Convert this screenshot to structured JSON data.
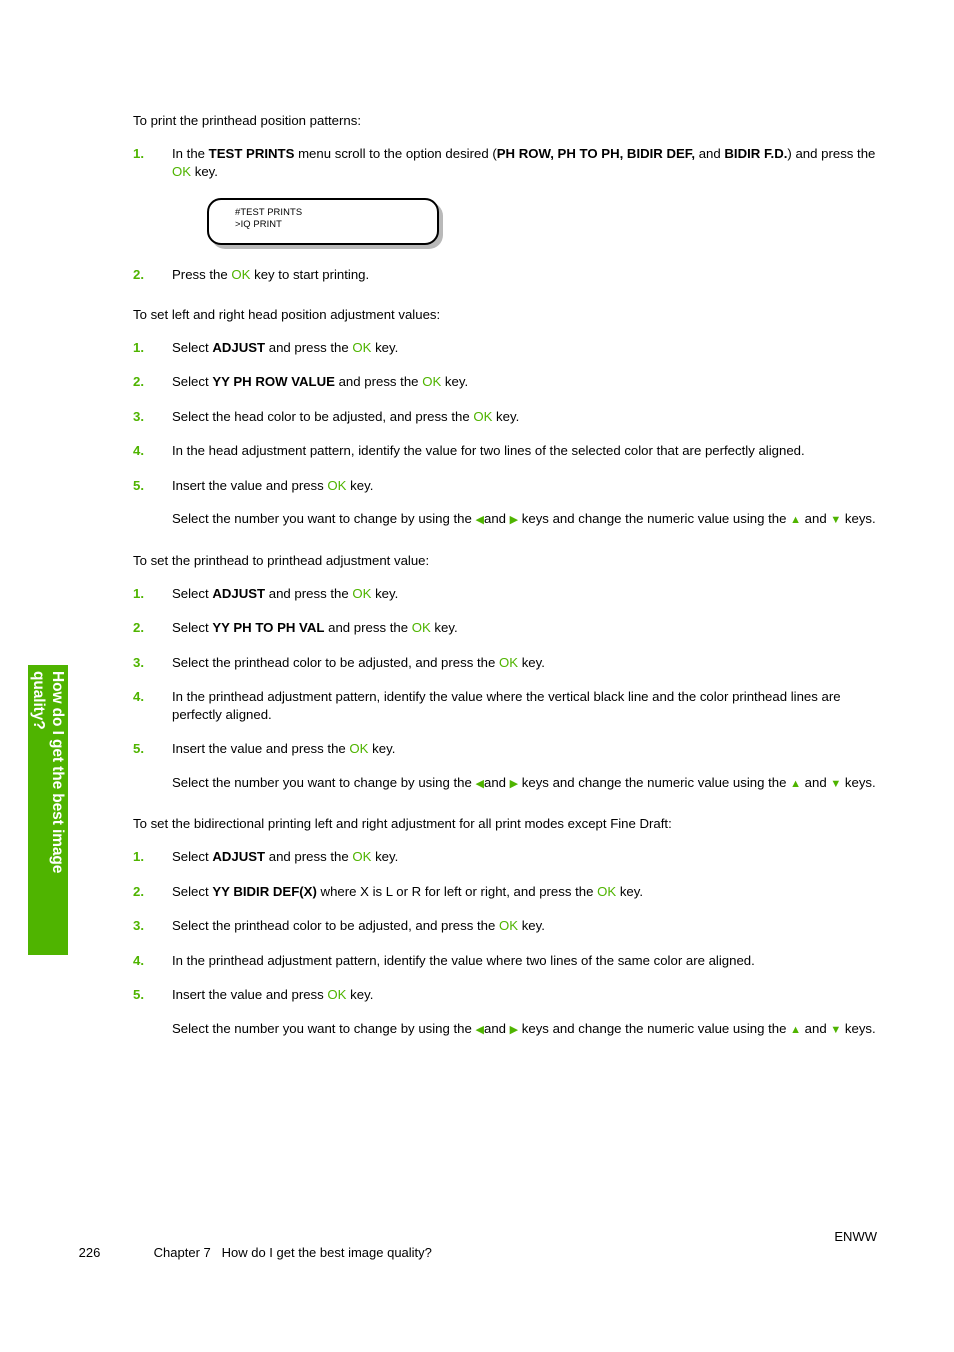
{
  "side_tab": {
    "line1": "How do I get the best image",
    "line2": "quality?",
    "color": "#4FB400"
  },
  "accent_color": "#4FB400",
  "sections": [
    {
      "lead": "To print the printhead position patterns:",
      "steps": [
        {
          "num": "1.",
          "parts": [
            {
              "t": "In the ",
              "style": "normal"
            },
            {
              "t": "TEST PRINTS",
              "style": "bold"
            },
            {
              "t": " menu scroll to the option desired (",
              "style": "normal"
            },
            {
              "t": "PH ROW, PH TO PH, BIDIR DEF,",
              "style": "bold"
            },
            {
              "t": " and ",
              "style": "normal"
            },
            {
              "t": "BIDIR F.D.",
              "style": "bold"
            },
            {
              "t": ") and press the ",
              "style": "normal"
            },
            {
              "t": "OK",
              "style": "ok"
            },
            {
              "t": " key.",
              "style": "normal"
            }
          ],
          "figure": {
            "type": "lcd-panel",
            "lines": [
              "#TEST PRINTS",
              ">IQ PRINT"
            ]
          }
        },
        {
          "num": "2.",
          "parts": [
            {
              "t": "Press the ",
              "style": "normal"
            },
            {
              "t": "OK",
              "style": "ok"
            },
            {
              "t": " key to start printing.",
              "style": "normal"
            }
          ]
        }
      ]
    },
    {
      "lead": "To set left and right head position adjustment values:",
      "steps": [
        {
          "num": "1.",
          "parts": [
            {
              "t": "Select ",
              "style": "normal"
            },
            {
              "t": "ADJUST",
              "style": "bold"
            },
            {
              "t": " and press the ",
              "style": "normal"
            },
            {
              "t": "OK",
              "style": "ok"
            },
            {
              "t": " key.",
              "style": "normal"
            }
          ]
        },
        {
          "num": "2.",
          "parts": [
            {
              "t": "Select ",
              "style": "normal"
            },
            {
              "t": "YY PH ROW VALUE",
              "style": "bold"
            },
            {
              "t": " and press the ",
              "style": "normal"
            },
            {
              "t": "OK",
              "style": "ok"
            },
            {
              "t": " key.",
              "style": "normal"
            }
          ]
        },
        {
          "num": "3.",
          "parts": [
            {
              "t": "Select the head color to be adjusted, and press the ",
              "style": "normal"
            },
            {
              "t": "OK",
              "style": "ok"
            },
            {
              "t": " key.",
              "style": "normal"
            }
          ]
        },
        {
          "num": "4.",
          "parts": [
            {
              "t": "In the head adjustment pattern, identify the value for two lines of the selected color that are perfectly aligned.",
              "style": "normal"
            }
          ]
        },
        {
          "num": "5.",
          "parts": [
            {
              "t": "Insert the value and press ",
              "style": "normal"
            },
            {
              "t": "OK",
              "style": "ok"
            },
            {
              "t": " key.",
              "style": "normal"
            }
          ],
          "sub_parts": [
            {
              "t": "Select the number you want to change by using the ",
              "style": "normal"
            },
            {
              "t": "◀",
              "style": "arrow"
            },
            {
              "t": "and ",
              "style": "normal"
            },
            {
              "t": "▶",
              "style": "arrow"
            },
            {
              "t": " keys and change the numeric value using the ",
              "style": "normal"
            },
            {
              "t": "▲",
              "style": "arrow"
            },
            {
              "t": " and ",
              "style": "normal"
            },
            {
              "t": "▼",
              "style": "arrow"
            },
            {
              "t": " keys.",
              "style": "normal"
            }
          ]
        }
      ]
    },
    {
      "lead": "To set the printhead to printhead adjustment value:",
      "steps": [
        {
          "num": "1.",
          "parts": [
            {
              "t": "Select ",
              "style": "normal"
            },
            {
              "t": "ADJUST",
              "style": "bold"
            },
            {
              "t": " and press the ",
              "style": "normal"
            },
            {
              "t": "OK",
              "style": "ok"
            },
            {
              "t": " key.",
              "style": "normal"
            }
          ]
        },
        {
          "num": "2.",
          "parts": [
            {
              "t": "Select ",
              "style": "normal"
            },
            {
              "t": "YY PH TO PH VAL",
              "style": "bold"
            },
            {
              "t": " and press the ",
              "style": "normal"
            },
            {
              "t": "OK",
              "style": "ok"
            },
            {
              "t": " key.",
              "style": "normal"
            }
          ]
        },
        {
          "num": "3.",
          "parts": [
            {
              "t": "Select the printhead color to be adjusted, and press the ",
              "style": "normal"
            },
            {
              "t": "OK",
              "style": "ok"
            },
            {
              "t": " key.",
              "style": "normal"
            }
          ]
        },
        {
          "num": "4.",
          "parts": [
            {
              "t": "In the printhead adjustment pattern, identify the value where the vertical black line and the color printhead lines are perfectly aligned.",
              "style": "normal"
            }
          ]
        },
        {
          "num": "5.",
          "parts": [
            {
              "t": "Insert the value and press the ",
              "style": "normal"
            },
            {
              "t": "OK",
              "style": "ok"
            },
            {
              "t": " key.",
              "style": "normal"
            }
          ],
          "sub_parts": [
            {
              "t": "Select the number you want to change by using the ",
              "style": "normal"
            },
            {
              "t": "◀",
              "style": "arrow"
            },
            {
              "t": "and ",
              "style": "normal"
            },
            {
              "t": "▶",
              "style": "arrow"
            },
            {
              "t": " keys and change the numeric value using the ",
              "style": "normal"
            },
            {
              "t": "▲",
              "style": "arrow"
            },
            {
              "t": " and ",
              "style": "normal"
            },
            {
              "t": "▼",
              "style": "arrow"
            },
            {
              "t": " keys.",
              "style": "normal"
            }
          ]
        }
      ]
    },
    {
      "lead": "To set the bidirectional printing left and right adjustment for all print modes except Fine Draft:",
      "steps": [
        {
          "num": "1.",
          "parts": [
            {
              "t": "Select ",
              "style": "normal"
            },
            {
              "t": "ADJUST",
              "style": "bold"
            },
            {
              "t": " and press the ",
              "style": "normal"
            },
            {
              "t": "OK",
              "style": "ok"
            },
            {
              "t": " key.",
              "style": "normal"
            }
          ]
        },
        {
          "num": "2.",
          "parts": [
            {
              "t": "Select ",
              "style": "normal"
            },
            {
              "t": "YY BIDIR DEF(X)",
              "style": "bold"
            },
            {
              "t": "  where X is L or R for left or right, and press the ",
              "style": "normal"
            },
            {
              "t": "OK",
              "style": "ok"
            },
            {
              "t": " key.",
              "style": "normal"
            }
          ]
        },
        {
          "num": "3.",
          "parts": [
            {
              "t": "Select the printhead color to be adjusted, and press the ",
              "style": "normal"
            },
            {
              "t": "OK",
              "style": "ok"
            },
            {
              "t": " key.",
              "style": "normal"
            }
          ]
        },
        {
          "num": "4.",
          "parts": [
            {
              "t": "In the printhead adjustment pattern, identify the value where two lines of the same color are aligned.",
              "style": "normal"
            }
          ]
        },
        {
          "num": "5.",
          "parts": [
            {
              "t": "Insert the value and press ",
              "style": "normal"
            },
            {
              "t": "OK",
              "style": "ok"
            },
            {
              "t": " key.",
              "style": "normal"
            }
          ],
          "sub_parts": [
            {
              "t": "Select the number you want to change by using the ",
              "style": "normal"
            },
            {
              "t": "◀",
              "style": "arrow"
            },
            {
              "t": "and ",
              "style": "normal"
            },
            {
              "t": "▶",
              "style": "arrow"
            },
            {
              "t": " keys and change the numeric value using the ",
              "style": "normal"
            },
            {
              "t": "▲",
              "style": "arrow"
            },
            {
              "t": " and ",
              "style": "normal"
            },
            {
              "t": "▼",
              "style": "arrow"
            },
            {
              "t": " keys.",
              "style": "normal"
            }
          ]
        }
      ]
    }
  ],
  "footer": {
    "page_number": "226",
    "chapter": "Chapter 7",
    "chapter_title": "How do I get the best image quality?",
    "locale": "ENWW"
  }
}
